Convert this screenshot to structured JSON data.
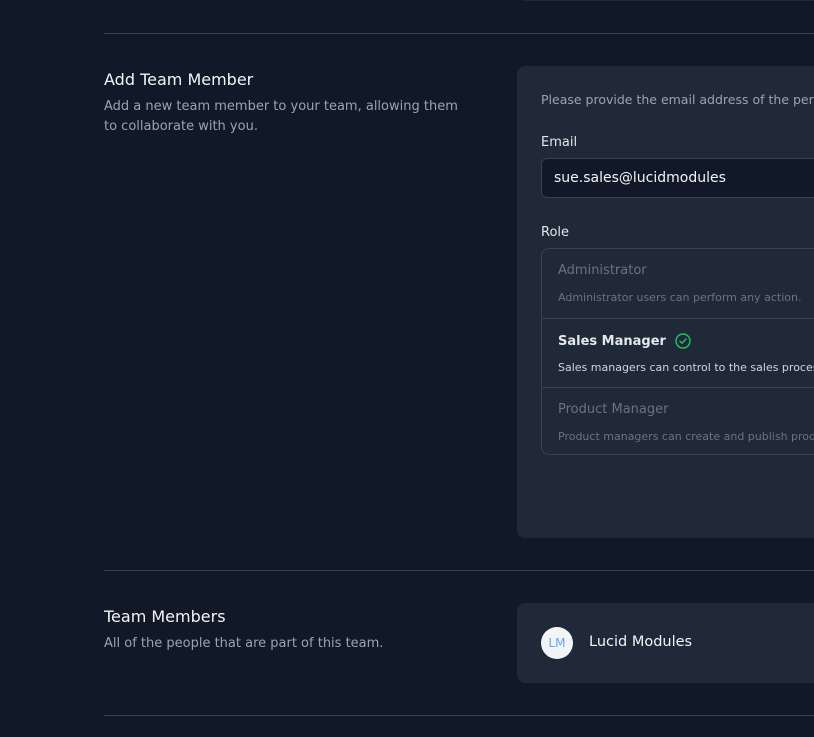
{
  "add_member": {
    "title": "Add Team Member",
    "description": "Add a new team member to your team, allowing them to collaborate with you.",
    "intro": "Please provide the email address of the person you would like to add to this team.",
    "email_label": "Email",
    "email_value": "sue.sales@lucidmodules",
    "role_label": "Role",
    "roles": [
      {
        "name": "Administrator",
        "description": "Administrator users can perform any action.",
        "selected": false
      },
      {
        "name": "Sales Manager",
        "description": "Sales managers can control to the sales process.",
        "selected": true
      },
      {
        "name": "Product Manager",
        "description": "Product managers can create and publish products.",
        "selected": false
      }
    ]
  },
  "team_members": {
    "title": "Team Members",
    "description": "All of the people that are part of this team.",
    "members": [
      {
        "initials": "LM",
        "name": "Lucid Modules"
      }
    ]
  },
  "colors": {
    "background": "#111827",
    "card": "#1f2937",
    "accent_check": "#22c55e",
    "avatar_text": "#60a5fa"
  },
  "icons": {
    "selected_role": "check-circle-icon"
  }
}
